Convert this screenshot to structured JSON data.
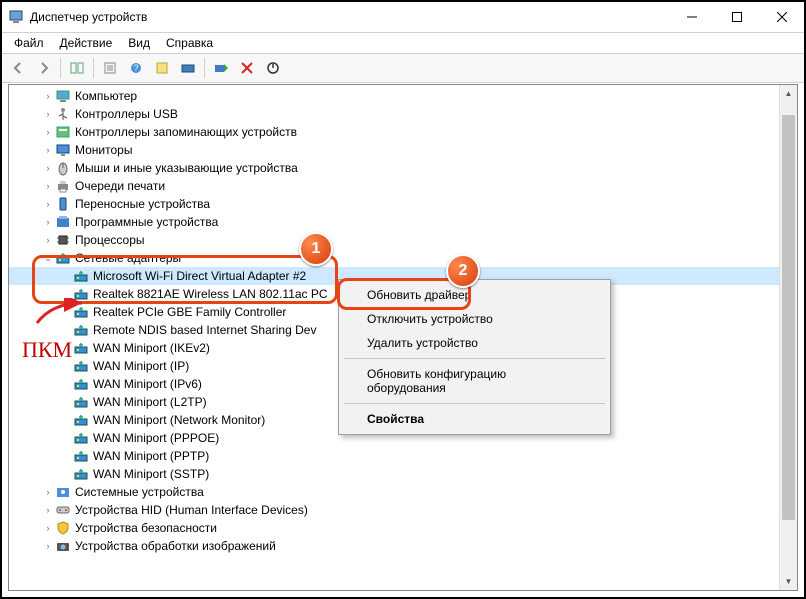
{
  "window": {
    "title": "Диспетчер устройств"
  },
  "menu": {
    "file": "Файл",
    "action": "Действие",
    "view": "Вид",
    "help": "Справка"
  },
  "annotations": {
    "pkm": "ПКМ",
    "badge1": "1",
    "badge2": "2"
  },
  "context_menu": {
    "update_driver": "Обновить драйвер",
    "disable_device": "Отключить устройство",
    "uninstall_device": "Удалить устройство",
    "scan_hw": "Обновить конфигурацию оборудования",
    "properties": "Свойства"
  },
  "tree": [
    {
      "depth": 1,
      "exp": ">",
      "icon": "computer",
      "label": "Компьютер"
    },
    {
      "depth": 1,
      "exp": ">",
      "icon": "usb",
      "label": "Контроллеры USB"
    },
    {
      "depth": 1,
      "exp": ">",
      "icon": "storage",
      "label": "Контроллеры запоминающих устройств"
    },
    {
      "depth": 1,
      "exp": ">",
      "icon": "monitor",
      "label": "Мониторы"
    },
    {
      "depth": 1,
      "exp": ">",
      "icon": "mouse",
      "label": "Мыши и иные указывающие устройства"
    },
    {
      "depth": 1,
      "exp": ">",
      "icon": "printer",
      "label": "Очереди печати"
    },
    {
      "depth": 1,
      "exp": ">",
      "icon": "portable",
      "label": "Переносные устройства"
    },
    {
      "depth": 1,
      "exp": ">",
      "icon": "software",
      "label": "Программные устройства"
    },
    {
      "depth": 1,
      "exp": ">",
      "icon": "cpu",
      "label": "Процессоры"
    },
    {
      "depth": 1,
      "exp": "v",
      "icon": "net",
      "label": "Сетевые адаптеры",
      "selected_cat": true
    },
    {
      "depth": 2,
      "exp": "",
      "icon": "net",
      "label": "Microsoft Wi-Fi Direct Virtual Adapter #2",
      "selected": true
    },
    {
      "depth": 2,
      "exp": "",
      "icon": "net",
      "label": "Realtek 8821AE Wireless LAN 802.11ac PC"
    },
    {
      "depth": 2,
      "exp": "",
      "icon": "net",
      "label": "Realtek PCIe GBE Family Controller"
    },
    {
      "depth": 2,
      "exp": "",
      "icon": "net",
      "label": "Remote NDIS based Internet Sharing Dev"
    },
    {
      "depth": 2,
      "exp": "",
      "icon": "net",
      "label": "WAN Miniport (IKEv2)"
    },
    {
      "depth": 2,
      "exp": "",
      "icon": "net",
      "label": "WAN Miniport (IP)"
    },
    {
      "depth": 2,
      "exp": "",
      "icon": "net",
      "label": "WAN Miniport (IPv6)"
    },
    {
      "depth": 2,
      "exp": "",
      "icon": "net",
      "label": "WAN Miniport (L2TP)"
    },
    {
      "depth": 2,
      "exp": "",
      "icon": "net",
      "label": "WAN Miniport (Network Monitor)"
    },
    {
      "depth": 2,
      "exp": "",
      "icon": "net",
      "label": "WAN Miniport (PPPOE)"
    },
    {
      "depth": 2,
      "exp": "",
      "icon": "net",
      "label": "WAN Miniport (PPTP)"
    },
    {
      "depth": 2,
      "exp": "",
      "icon": "net",
      "label": "WAN Miniport (SSTP)"
    },
    {
      "depth": 1,
      "exp": ">",
      "icon": "system",
      "label": "Системные устройства"
    },
    {
      "depth": 1,
      "exp": ">",
      "icon": "hid",
      "label": "Устройства HID (Human Interface Devices)"
    },
    {
      "depth": 1,
      "exp": ">",
      "icon": "security",
      "label": "Устройства безопасности"
    },
    {
      "depth": 1,
      "exp": ">",
      "icon": "imaging",
      "label": "Устройства обработки изображений"
    }
  ]
}
